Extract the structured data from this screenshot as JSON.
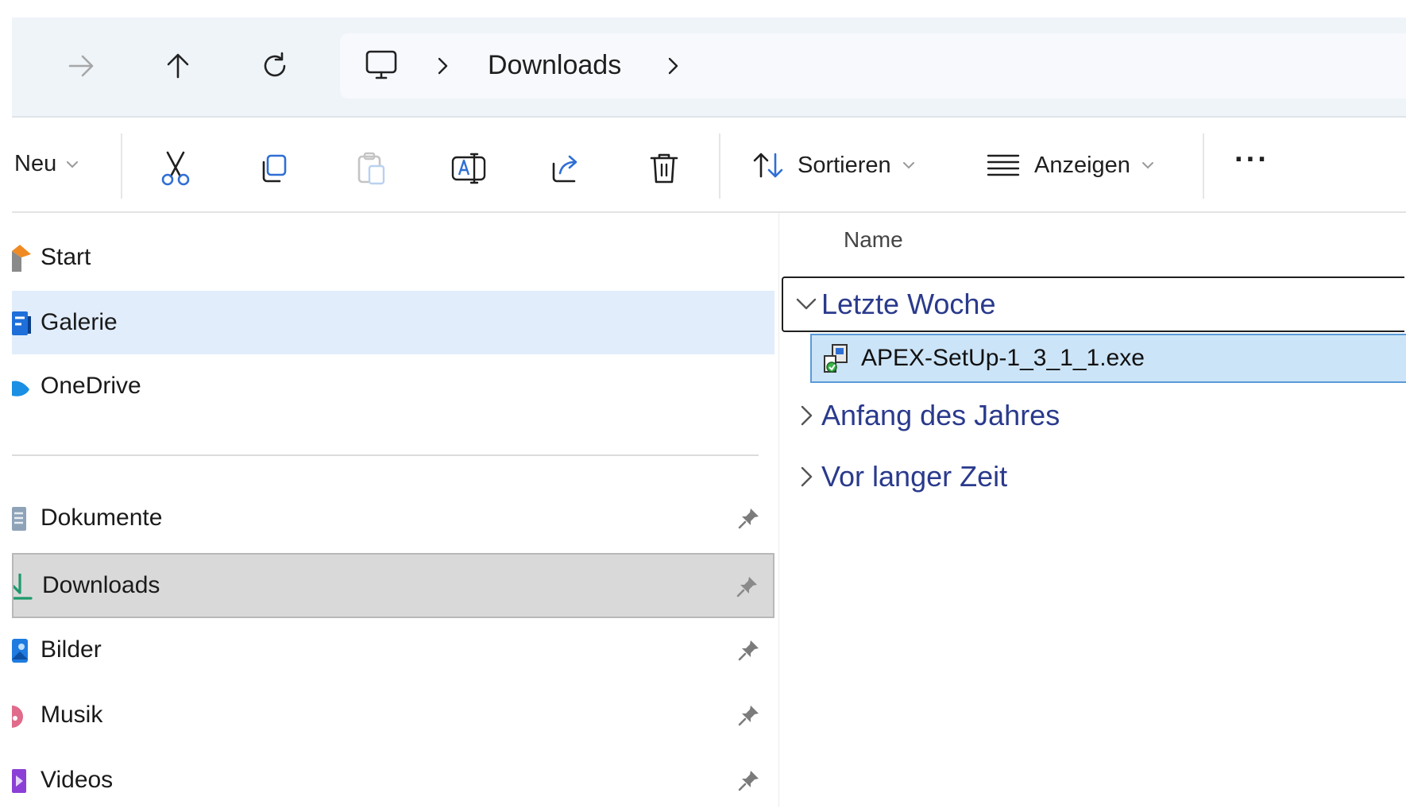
{
  "address_bar": {
    "breadcrumb": [
      "Downloads"
    ],
    "icons": {
      "forward": "arrow-right-icon",
      "up": "arrow-up-icon",
      "refresh": "refresh-icon",
      "location": "monitor-icon",
      "separator": "chevron-right-icon"
    }
  },
  "toolbar": {
    "new_label": "Neu",
    "sort_label": "Sortieren",
    "view_label": "Anzeigen",
    "more_label": "···",
    "icons": [
      "cut-icon",
      "copy-icon",
      "paste-icon",
      "rename-icon",
      "share-icon",
      "delete-icon",
      "sort-icon",
      "view-icon"
    ]
  },
  "nav_pane": {
    "top_items": [
      {
        "label": "Start",
        "icon": "home-icon",
        "selected": false
      },
      {
        "label": "Galerie",
        "icon": "gallery-icon",
        "selected": true
      },
      {
        "label": "OneDrive",
        "icon": "cloud-icon",
        "selected": false
      }
    ],
    "pinned_items": [
      {
        "label": "Dokumente",
        "icon": "documents-icon",
        "pinned": true
      },
      {
        "label": "Downloads",
        "icon": "download-icon",
        "pinned": true,
        "active": true
      },
      {
        "label": "Bilder",
        "icon": "pictures-icon",
        "pinned": true
      },
      {
        "label": "Musik",
        "icon": "music-icon",
        "pinned": true
      },
      {
        "label": "Videos",
        "icon": "videos-icon",
        "pinned": true
      }
    ]
  },
  "file_list": {
    "column_name": "Name",
    "groups": [
      {
        "label": "Letzte Woche",
        "expanded": true,
        "files": [
          {
            "name": "APEX-SetUp-1_3_1_1.exe",
            "icon": "installer-icon",
            "selected": true
          }
        ]
      },
      {
        "label": "Anfang des Jahres",
        "expanded": false,
        "files": []
      },
      {
        "label": "Vor langer Zeit",
        "expanded": false,
        "files": []
      }
    ]
  },
  "colors": {
    "accent": "#2a3a8c",
    "selection": "#cce4f7",
    "nav_selected": "#e1edfb",
    "nav_active": "#d9d9d9"
  }
}
